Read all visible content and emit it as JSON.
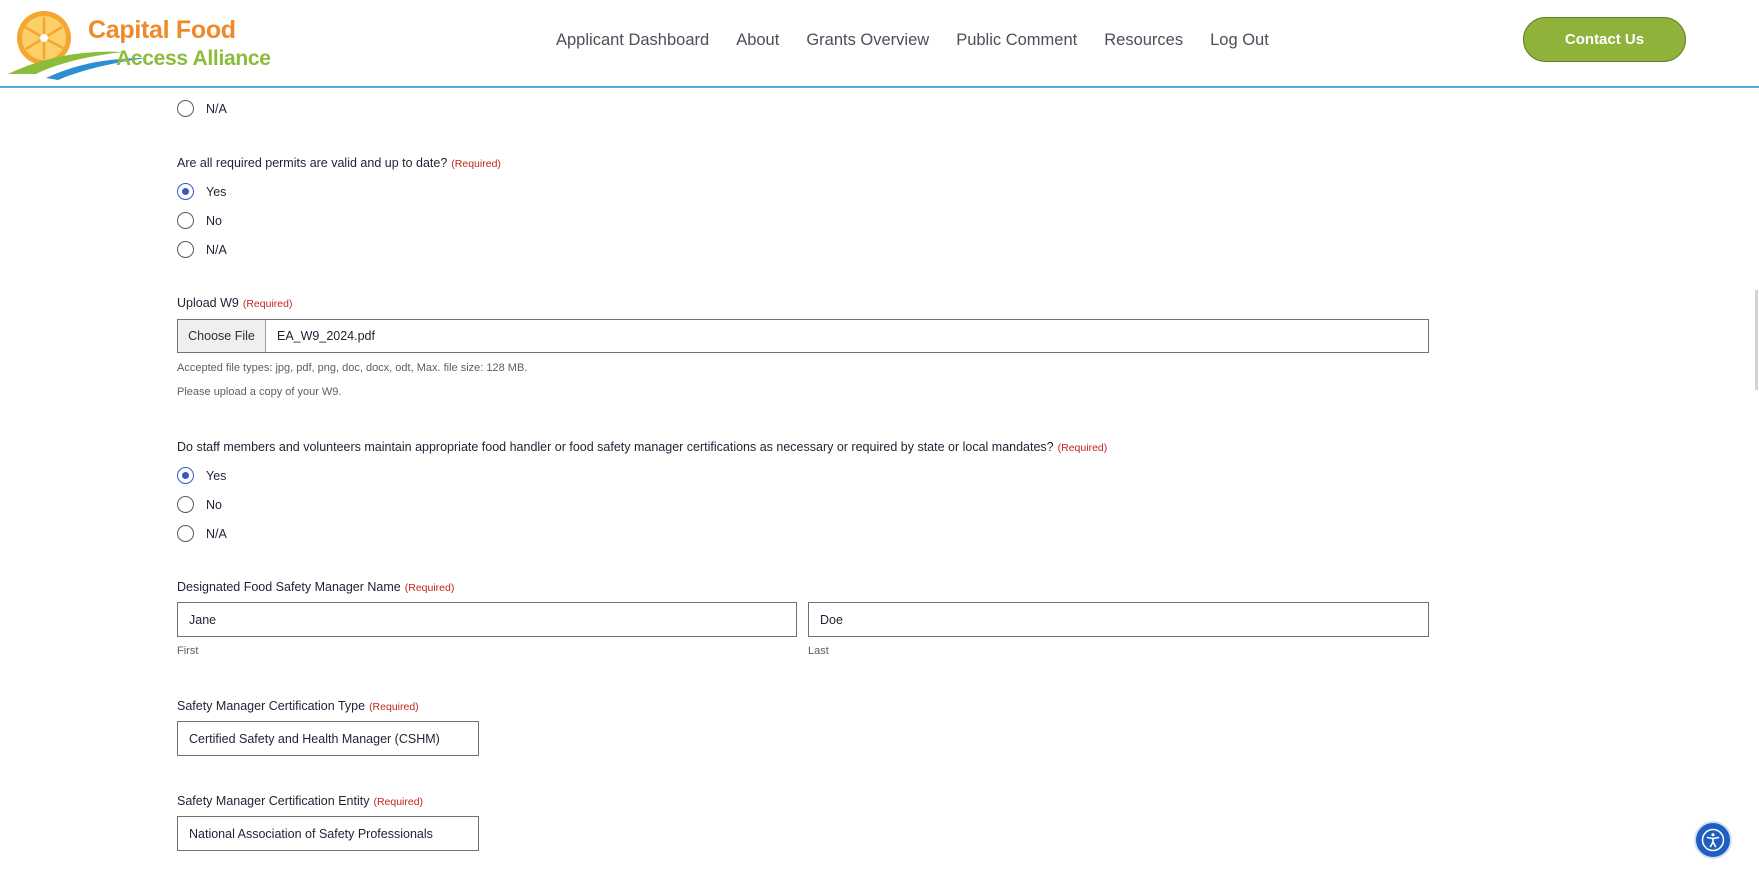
{
  "header": {
    "logo_line1": "Capital Food",
    "logo_line2": "Access Alliance",
    "nav": [
      {
        "label": "Applicant Dashboard"
      },
      {
        "label": "About"
      },
      {
        "label": "Grants Overview"
      },
      {
        "label": "Public Comment"
      },
      {
        "label": "Resources"
      },
      {
        "label": "Log Out"
      }
    ],
    "contact_label": "Contact Us"
  },
  "form": {
    "required_tag": "(Required)",
    "prev_question": {
      "options": [
        {
          "label": "N/A",
          "checked": false
        }
      ]
    },
    "permits": {
      "question": "Are all required permits are valid and up to date?",
      "options": [
        {
          "label": "Yes",
          "checked": true
        },
        {
          "label": "No",
          "checked": false
        },
        {
          "label": "N/A",
          "checked": false
        }
      ]
    },
    "w9": {
      "label": "Upload W9",
      "choose_label": "Choose File",
      "file_name": "EA_W9_2024.pdf",
      "accepted_types": "Accepted file types: jpg, pdf, png, doc, docx, odt, Max. file size: 128 MB.",
      "description": "Please upload a copy of your W9."
    },
    "certifications": {
      "question": "Do staff members and volunteers maintain appropriate food handler or food safety manager certifications as necessary or required by state or local mandates?",
      "options": [
        {
          "label": "Yes",
          "checked": true
        },
        {
          "label": "No",
          "checked": false
        },
        {
          "label": "N/A",
          "checked": false
        }
      ]
    },
    "manager_name": {
      "label": "Designated Food Safety Manager Name",
      "first_value": "Jane",
      "first_sub": "First",
      "last_value": "Doe",
      "last_sub": "Last"
    },
    "cert_type": {
      "label": "Safety Manager Certification Type",
      "value": "Certified Safety and Health Manager (CSHM)"
    },
    "cert_entity": {
      "label": "Safety Manager Certification Entity",
      "value": "National Association of Safety Professionals"
    }
  },
  "colors": {
    "accent_orange": "#ef8a2a",
    "accent_green": "#8fb33a",
    "header_border": "#5aa9d6",
    "required_red": "#c0271d",
    "radio_blue": "#3a56c4",
    "a11y_blue": "#1f5fbf"
  },
  "icons": {
    "logo": "orange-slice-logo-icon",
    "accessibility": "accessibility-person-icon"
  }
}
